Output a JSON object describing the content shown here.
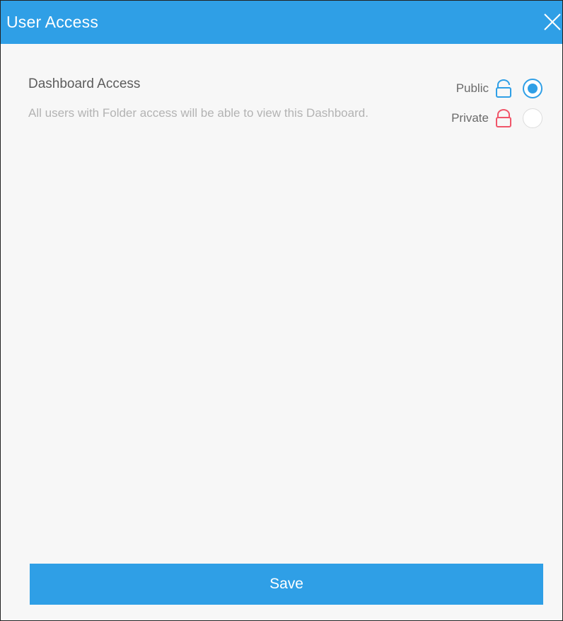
{
  "dialog": {
    "title": "User Access",
    "close_icon": "close-icon"
  },
  "dashboard_access": {
    "title": "Dashboard Access",
    "description": "All users with Folder access will be able to view this Dashboard.",
    "options": [
      {
        "label": "Public",
        "icon": "unlocked-icon",
        "icon_color": "#2f9fe6",
        "selected": true
      },
      {
        "label": "Private",
        "icon": "locked-icon",
        "icon_color": "#f0566a",
        "selected": false
      }
    ]
  },
  "actions": {
    "save_label": "Save"
  },
  "colors": {
    "accent": "#2f9fe6",
    "private_lock": "#f0566a",
    "panel_background": "#f7f7f7"
  }
}
